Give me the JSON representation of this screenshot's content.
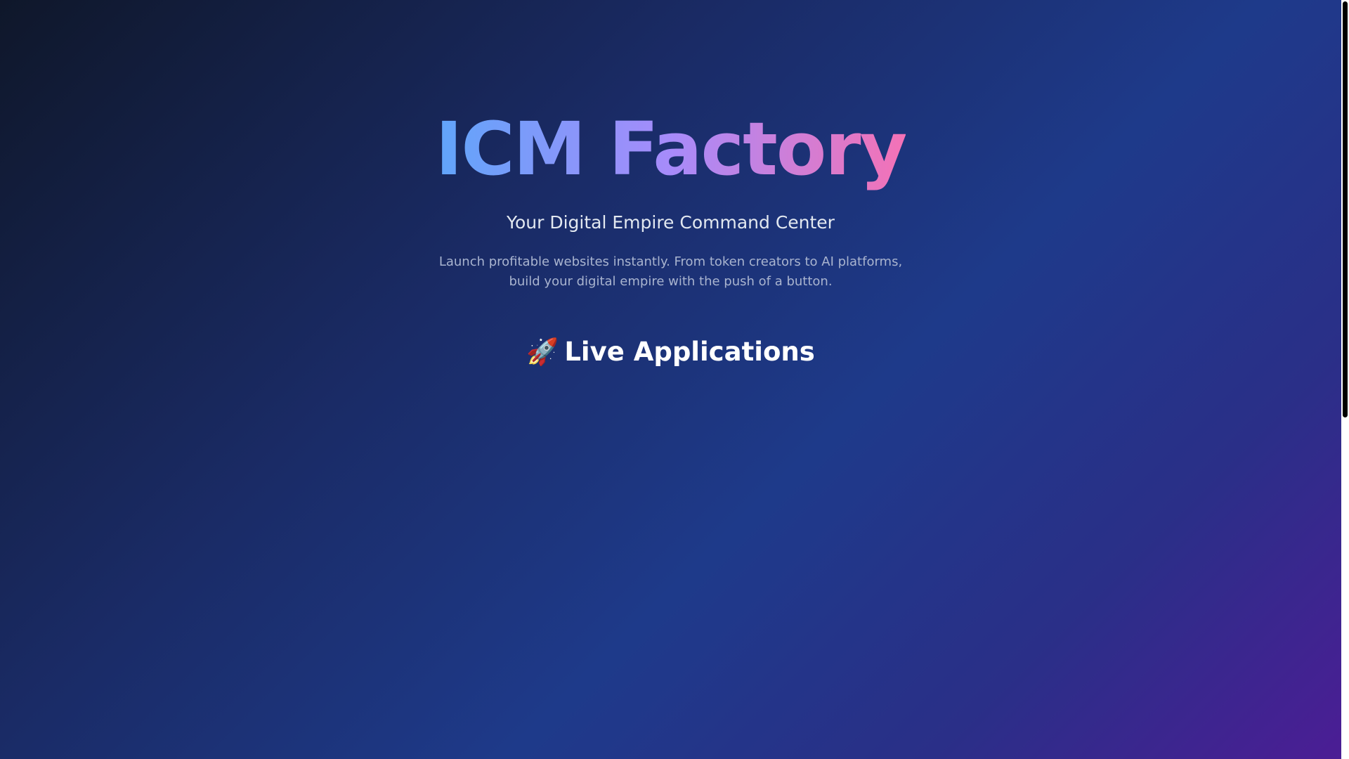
{
  "hero": {
    "title": "ICM Factory",
    "subtitle": "Your Digital Empire Command Center",
    "description": "Launch profitable websites instantly. From token creators to AI platforms, build your digital empire with the push of a button."
  },
  "section": {
    "icon": "🚀",
    "icon_name": "rocket-icon",
    "title": "Live Applications"
  },
  "colors": {
    "title_gradient_start": "#60a5fa",
    "title_gradient_mid": "#a78bfa",
    "title_gradient_end": "#f472b6",
    "background_start": "#0f172a",
    "background_mid": "#1e3a8a",
    "background_end": "#4c1d95"
  }
}
